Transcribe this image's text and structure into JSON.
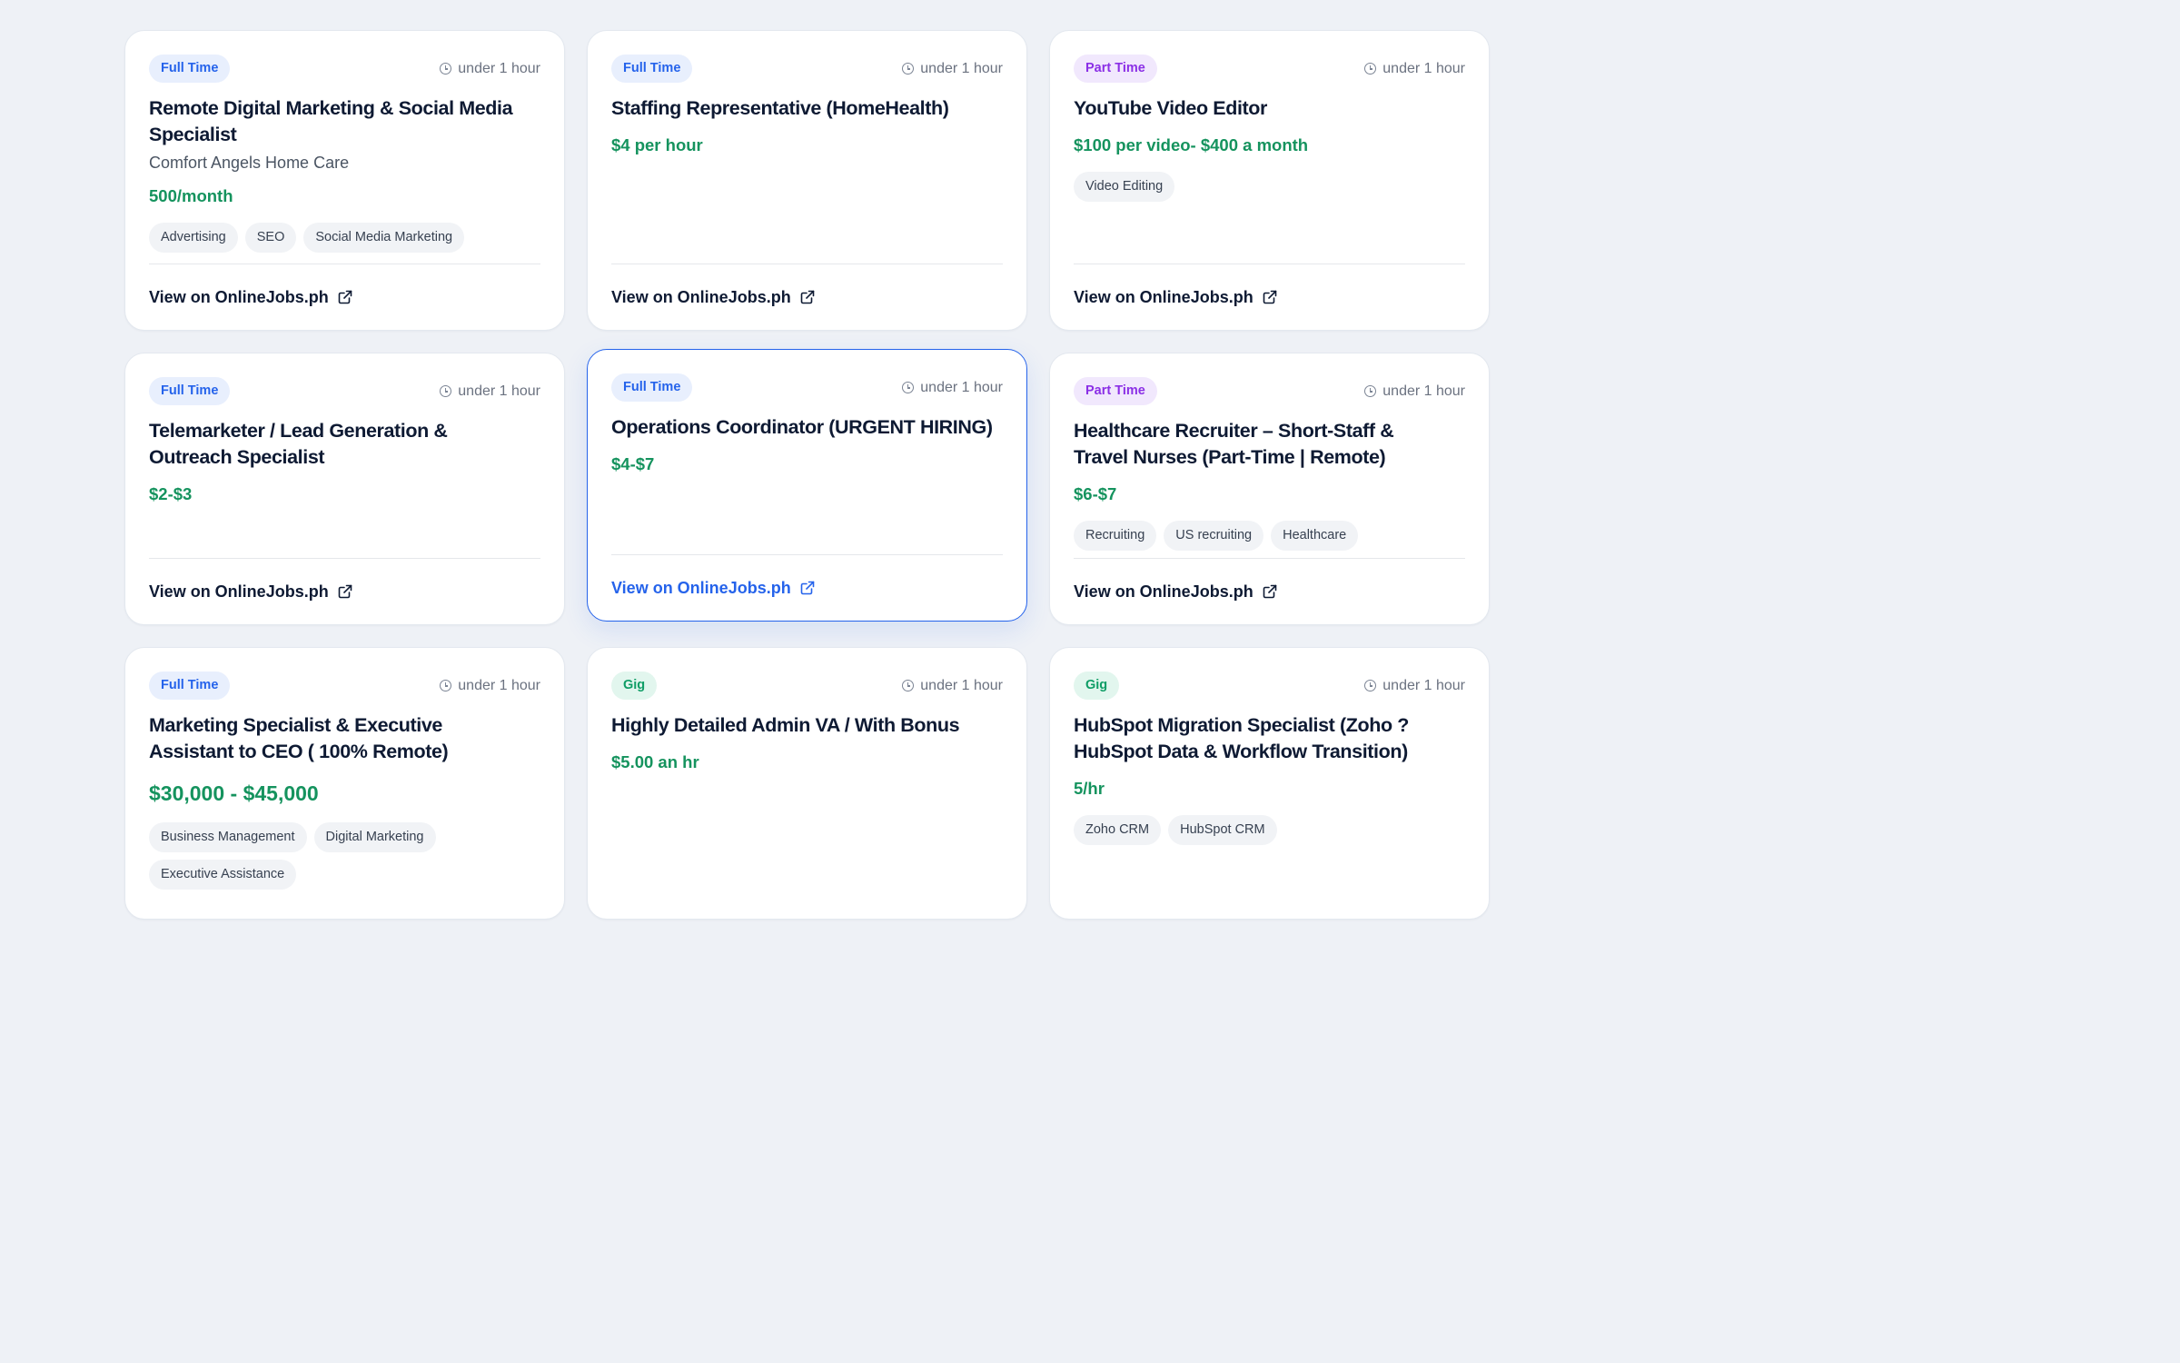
{
  "link_label": "View on OnlineJobs.ph",
  "cards": [
    {
      "type": "Full Time",
      "time": "under 1 hour",
      "title_lines": [
        "Remote Digital Marketing & Social Media",
        "Specialist"
      ],
      "company": "Comfort Angels Home Care",
      "salary": "500/month",
      "tags": [
        "Advertising",
        "SEO",
        "Social Media Marketing"
      ]
    },
    {
      "type": "Full Time",
      "time": "under 1 hour",
      "title_lines": [
        "Staffing Representative (HomeHealth)"
      ],
      "salary": "$4 per hour",
      "tags": []
    },
    {
      "type": "Part Time",
      "time": "under 1 hour",
      "title_lines": [
        "YouTube Video Editor"
      ],
      "salary": "$100 per video- $400 a month",
      "tags": [
        "Video Editing"
      ]
    },
    {
      "type": "Full Time",
      "time": "under 1 hour",
      "title_lines": [
        "Telemarketer / Lead Generation &",
        "Outreach Specialist"
      ],
      "salary": "$2-$3",
      "tags": []
    },
    {
      "type": "Full Time",
      "time": "under 1 hour",
      "title_lines": [
        "Operations Coordinator (URGENT HIRING)"
      ],
      "salary": "$4-$7",
      "tags": []
    },
    {
      "type": "Part Time",
      "time": "under 1 hour",
      "title_lines": [
        "Healthcare Recruiter – Short-Staff &",
        "Travel Nurses (Part-Time | Remote)"
      ],
      "salary": "$6-$7",
      "tags": [
        "Recruiting",
        "US recruiting",
        "Healthcare"
      ]
    },
    {
      "type": "Full Time",
      "time": "under 1 hour",
      "title_lines": [
        "Marketing Specialist & Executive",
        "Assistant to CEO ( 100% Remote)"
      ],
      "salary": "$30,000 - $45,000",
      "tags": [
        "Business Management",
        "Digital Marketing",
        "Executive Assistance"
      ]
    },
    {
      "type": "Gig",
      "time": "under 1 hour",
      "title_lines": [
        "Highly Detailed Admin VA / With Bonus"
      ],
      "salary": "$5.00 an hr",
      "tags": []
    },
    {
      "type": "Gig",
      "time": "under 1 hour",
      "title_lines": [
        "HubSpot Migration Specialist (Zoho ?",
        "HubSpot Data & Workflow Transition)"
      ],
      "salary": "5/hr",
      "tags": [
        "Zoho CRM",
        "HubSpot CRM"
      ]
    }
  ]
}
